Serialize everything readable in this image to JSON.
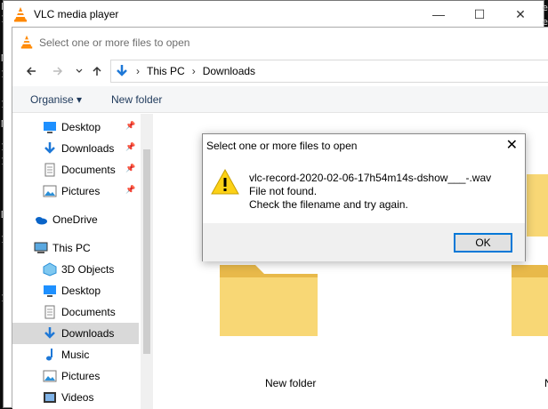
{
  "background_console": {
    "left_chars": [
      "Pr",
      "1",
      "1",
      "N",
      "1",
      "1",
      "1",
      "N",
      "1",
      "1",
      "D",
      "1",
      "1"
    ],
    "right_chars": [
      "e",
      "e"
    ]
  },
  "vlc_window": {
    "title": "VLC media player",
    "controls": {
      "minimize": "—",
      "maximize": "☐",
      "close": "✕"
    }
  },
  "file_dialog": {
    "title": "Select one or more files to open",
    "breadcrumb": [
      "This PC",
      "Downloads"
    ],
    "toolbar": {
      "organise": "Organise ▾",
      "new_folder": "New folder"
    },
    "nav_items": [
      {
        "label": "Desktop",
        "icon": "desktop-icon",
        "pinned": true,
        "selected": false
      },
      {
        "label": "Downloads",
        "icon": "downloads-icon",
        "pinned": true,
        "selected": false
      },
      {
        "label": "Documents",
        "icon": "documents-icon",
        "pinned": true,
        "selected": false
      },
      {
        "label": "Pictures",
        "icon": "pictures-icon",
        "pinned": true,
        "selected": false
      },
      {
        "label": "OneDrive",
        "icon": "onedrive-icon",
        "pinned": false,
        "selected": false
      },
      {
        "label": "This PC",
        "icon": "this-pc-icon",
        "pinned": false,
        "selected": false
      },
      {
        "label": "3D Objects",
        "icon": "3d-objects-icon",
        "pinned": false,
        "selected": false
      },
      {
        "label": "Desktop",
        "icon": "desktop-icon",
        "pinned": false,
        "selected": false
      },
      {
        "label": "Documents",
        "icon": "documents-icon",
        "pinned": false,
        "selected": false
      },
      {
        "label": "Downloads",
        "icon": "downloads-icon",
        "pinned": false,
        "selected": true
      },
      {
        "label": "Music",
        "icon": "music-icon",
        "pinned": false,
        "selected": false
      },
      {
        "label": "Pictures",
        "icon": "pictures-icon",
        "pinned": false,
        "selected": false
      },
      {
        "label": "Videos",
        "icon": "videos-icon",
        "pinned": false,
        "selected": false
      }
    ],
    "folders": [
      {
        "label": "New folder"
      },
      {
        "label": "N"
      }
    ]
  },
  "error_dialog": {
    "title": "Select one or more files to open",
    "close": "✕",
    "message_lines": [
      "vlc-record-2020-02-06-17h54m14s-dshow___-.wav",
      "File not found.",
      "Check the filename and try again."
    ],
    "ok_label": "OK"
  },
  "colors": {
    "vlc_orange": "#ff8800",
    "accent_blue": "#0078d7",
    "folder_yellow": "#f8d775",
    "selected_row": "#d9d9d9"
  }
}
